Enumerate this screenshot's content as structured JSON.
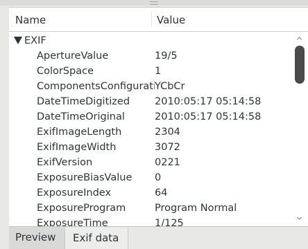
{
  "columns": {
    "name": "Name",
    "value": "Value"
  },
  "group": {
    "label": "EXIF",
    "expanded": true
  },
  "rows": [
    {
      "name": "ApertureValue",
      "value": "19/5"
    },
    {
      "name": "ColorSpace",
      "value": "1"
    },
    {
      "name": "ComponentsConfiguration",
      "value": "YCbCr"
    },
    {
      "name": "DateTimeDigitized",
      "value": "2010:05:17 05:14:58"
    },
    {
      "name": "DateTimeOriginal",
      "value": "2010:05:17 05:14:58"
    },
    {
      "name": "ExifImageLength",
      "value": "2304"
    },
    {
      "name": "ExifImageWidth",
      "value": "3072"
    },
    {
      "name": "ExifVersion",
      "value": "0221"
    },
    {
      "name": "ExposureBiasValue",
      "value": "0"
    },
    {
      "name": "ExposureIndex",
      "value": "64"
    },
    {
      "name": "ExposureProgram",
      "value": "Program Normal"
    },
    {
      "name": "ExposureTime",
      "value": "1/125"
    }
  ],
  "tabs": [
    {
      "label": "Preview",
      "active": false
    },
    {
      "label": "Exif data",
      "active": true
    }
  ],
  "icons": {
    "expander": "triangle-down-icon",
    "scroll_up": "chevron-up-icon",
    "scroll_down": "chevron-down-icon"
  },
  "colors": {
    "text": "#2e3436",
    "background": "#e8e8e7",
    "list_background": "#ffffff",
    "scroll_thumb": "#4a4a4a"
  }
}
